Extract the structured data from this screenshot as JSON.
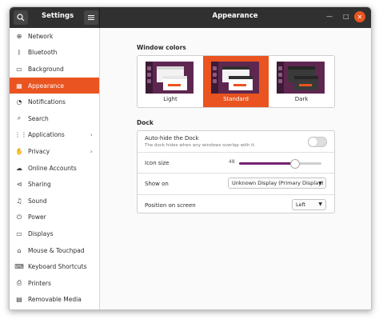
{
  "titlebar": {
    "app_title": "Settings",
    "page_title": "Appearance",
    "search_icon": "search-icon",
    "menu_icon": "hamburger-menu-icon",
    "minimize_glyph": "—",
    "maximize_glyph": "□",
    "close_glyph": "✕"
  },
  "sidebar": {
    "items": [
      {
        "label": "Network",
        "icon": "⊕",
        "icon_name": "network-icon"
      },
      {
        "label": "Bluetooth",
        "icon": "ᛒ",
        "icon_name": "bluetooth-icon"
      },
      {
        "label": "Background",
        "icon": "▭",
        "icon_name": "background-icon"
      },
      {
        "label": "Appearance",
        "icon": "▦",
        "icon_name": "appearance-icon",
        "active": true
      },
      {
        "label": "Notifications",
        "icon": "◔",
        "icon_name": "notifications-icon"
      },
      {
        "label": "Search",
        "icon": "⌕",
        "icon_name": "search-icon"
      },
      {
        "label": "Applications",
        "icon": "⋮⋮",
        "icon_name": "applications-icon",
        "chevron": "›"
      },
      {
        "label": "Privacy",
        "icon": "✋",
        "icon_name": "privacy-icon",
        "chevron": "›"
      },
      {
        "label": "Online Accounts",
        "icon": "☁",
        "icon_name": "online-accounts-icon"
      },
      {
        "label": "Sharing",
        "icon": "⊲",
        "icon_name": "sharing-icon"
      },
      {
        "label": "Sound",
        "icon": "♫",
        "icon_name": "sound-icon"
      },
      {
        "label": "Power",
        "icon": "⏻",
        "icon_name": "power-icon"
      },
      {
        "label": "Displays",
        "icon": "▭",
        "icon_name": "displays-icon"
      },
      {
        "label": "Mouse & Touchpad",
        "icon": "⌂",
        "icon_name": "mouse-icon"
      },
      {
        "label": "Keyboard Shortcuts",
        "icon": "⌨",
        "icon_name": "keyboard-icon"
      },
      {
        "label": "Printers",
        "icon": "⎙",
        "icon_name": "printers-icon"
      },
      {
        "label": "Removable Media",
        "icon": "▤",
        "icon_name": "removable-media-icon"
      }
    ]
  },
  "window_colors": {
    "heading": "Window colors",
    "options": [
      {
        "label": "Light",
        "selected": false
      },
      {
        "label": "Standard",
        "selected": true
      },
      {
        "label": "Dark",
        "selected": false
      }
    ]
  },
  "dock": {
    "heading": "Dock",
    "autohide": {
      "label": "Auto-hide the Dock",
      "sublabel": "The dock hides when any windows overlap with it.",
      "enabled": false
    },
    "icon_size": {
      "label": "Icon size",
      "value": "48",
      "fraction": 0.67
    },
    "show_on": {
      "label": "Show on",
      "value": "Unknown Display (Primary Display)"
    },
    "position": {
      "label": "Position on screen",
      "value": "Left"
    }
  },
  "colors": {
    "accent": "#e95420",
    "aubergine": "#77216f",
    "titlebar": "#303030"
  }
}
